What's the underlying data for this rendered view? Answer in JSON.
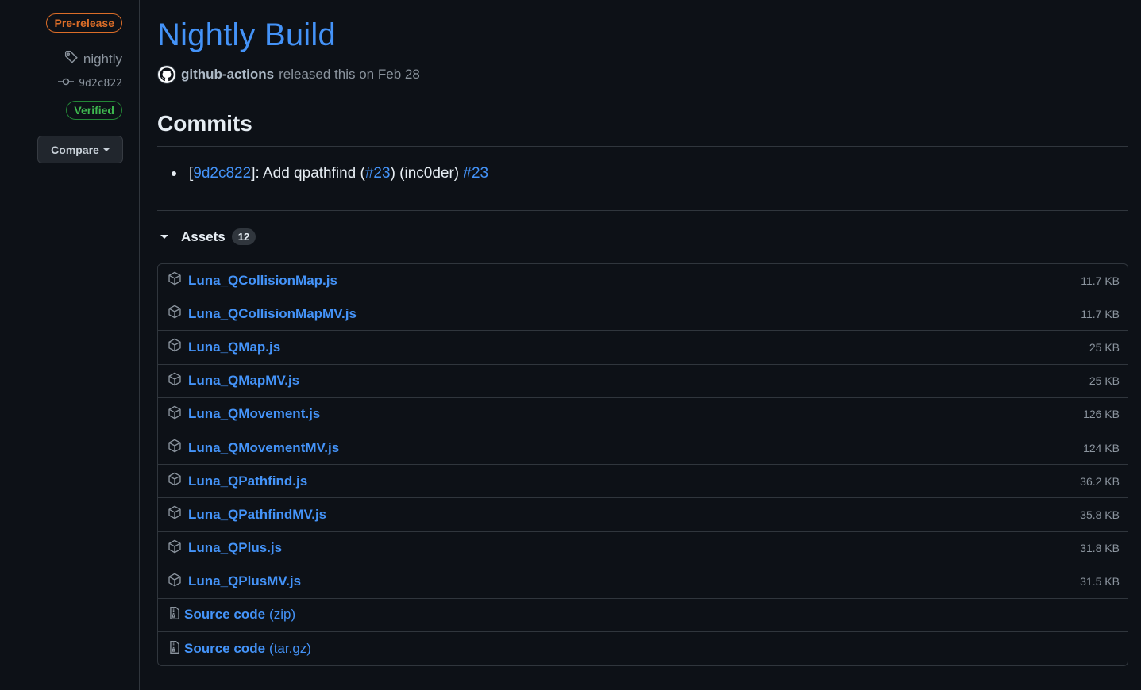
{
  "sidebar": {
    "prerelease_label": "Pre-release",
    "tag_name": "nightly",
    "commit_sha": "9d2c822",
    "verified_label": "Verified",
    "compare_label": "Compare"
  },
  "release": {
    "title": "Nightly Build",
    "author": "github-actions",
    "released_text": "released this on Feb 28"
  },
  "commits": {
    "heading": "Commits",
    "items": [
      {
        "open_bracket": "[",
        "sha": "9d2c822",
        "message_start": "]: Add qpathfind (",
        "pr_ref": "#23",
        "message_end": ") (inc0der) ",
        "pr_link": "#23"
      }
    ]
  },
  "assets": {
    "heading": "Assets",
    "count": "12",
    "items": [
      {
        "name": "Luna_QCollisionMap.js",
        "size": "11.7 KB"
      },
      {
        "name": "Luna_QCollisionMapMV.js",
        "size": "11.7 KB"
      },
      {
        "name": "Luna_QMap.js",
        "size": "25 KB"
      },
      {
        "name": "Luna_QMapMV.js",
        "size": "25 KB"
      },
      {
        "name": "Luna_QMovement.js",
        "size": "126 KB"
      },
      {
        "name": "Luna_QMovementMV.js",
        "size": "124 KB"
      },
      {
        "name": "Luna_QPathfind.js",
        "size": "36.2 KB"
      },
      {
        "name": "Luna_QPathfindMV.js",
        "size": "35.8 KB"
      },
      {
        "name": "Luna_QPlus.js",
        "size": "31.8 KB"
      },
      {
        "name": "Luna_QPlusMV.js",
        "size": "31.5 KB"
      }
    ],
    "source": [
      {
        "name": "Source code",
        "ext": "(zip)"
      },
      {
        "name": "Source code",
        "ext": "(tar.gz)"
      }
    ]
  },
  "colors": {
    "background": "#0d1117",
    "link": "#4493f8",
    "prerelease": "#db6d28",
    "verified": "#3fb950",
    "muted": "#8b949e"
  }
}
